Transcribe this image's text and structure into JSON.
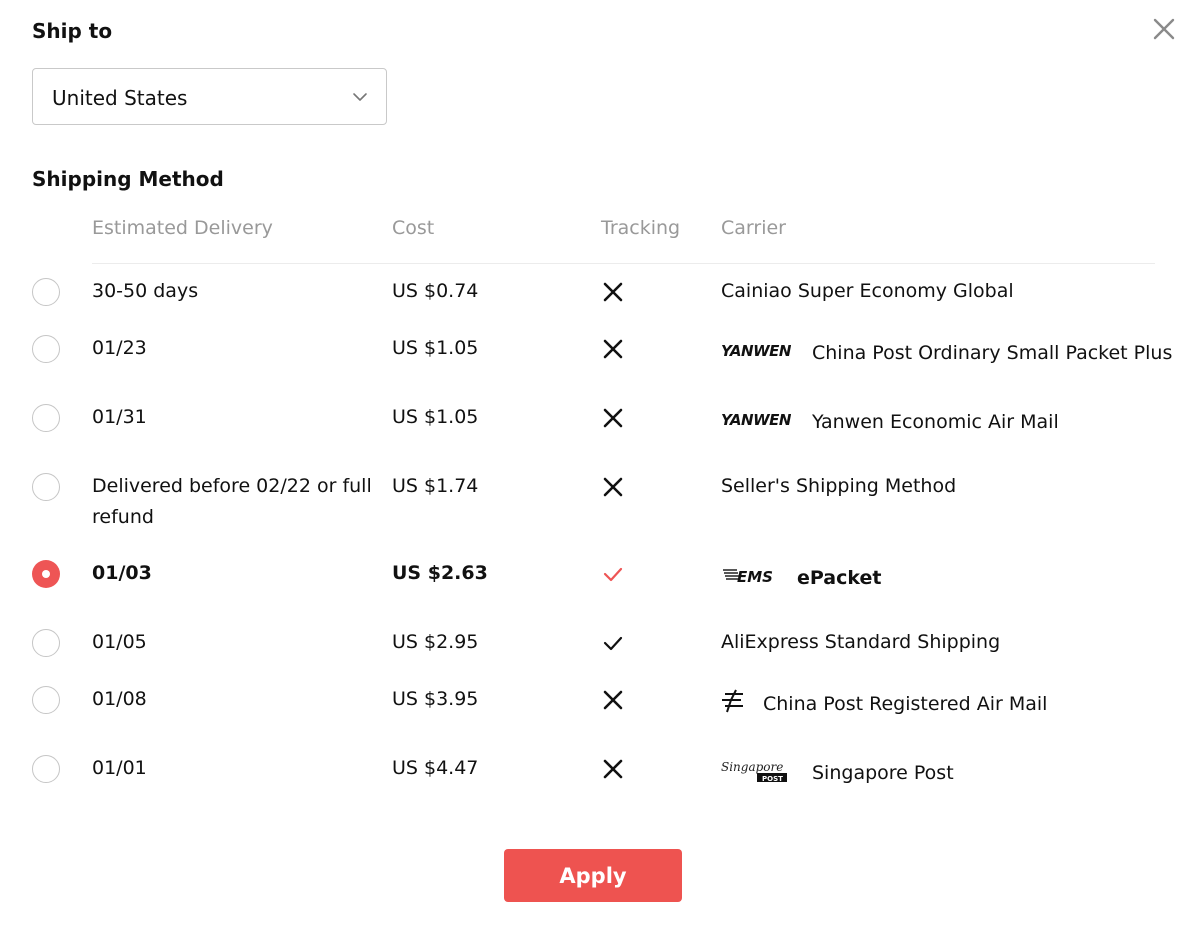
{
  "ship_to": {
    "title": "Ship to",
    "selected_country": "United States"
  },
  "shipping_method": {
    "title": "Shipping Method",
    "columns": [
      "Estimated Delivery",
      "Cost",
      "Tracking",
      "Carrier"
    ],
    "rows": [
      {
        "delivery": "30-50 days",
        "cost": "US $0.74",
        "tracking": false,
        "carrier": "Cainiao Super Economy Global",
        "logo": null,
        "selected": false
      },
      {
        "delivery": "01/23",
        "cost": "US $1.05",
        "tracking": false,
        "carrier": "China Post Ordinary Small Packet Plus",
        "logo": "yanwen-logo",
        "logo_text": "YANWEN",
        "selected": false
      },
      {
        "delivery": "01/31",
        "cost": "US $1.05",
        "tracking": false,
        "carrier": "Yanwen Economic Air Mail",
        "logo": "yanwen-logo",
        "logo_text": "YANWEN",
        "selected": false
      },
      {
        "delivery": "Delivered before 02/22 or full refund",
        "cost": "US $1.74",
        "tracking": false,
        "carrier": "Seller's Shipping Method",
        "logo": null,
        "selected": false
      },
      {
        "delivery": "01/03",
        "cost": "US $2.63",
        "tracking": true,
        "carrier": "ePacket",
        "logo": "ems-logo",
        "logo_text": "EMS",
        "selected": true
      },
      {
        "delivery": "01/05",
        "cost": "US $2.95",
        "tracking": true,
        "carrier": "AliExpress Standard Shipping",
        "logo": null,
        "selected": false
      },
      {
        "delivery": "01/08",
        "cost": "US $3.95",
        "tracking": false,
        "carrier": "China Post Registered Air Mail",
        "logo": "china-post-logo",
        "selected": false
      },
      {
        "delivery": "01/01",
        "cost": "US $4.47",
        "tracking": false,
        "carrier": "Singapore Post",
        "logo": "singapore-post-logo",
        "logo_text": "Singapore",
        "logo_subtext": "POST",
        "selected": false
      }
    ]
  },
  "apply_label": "Apply",
  "colors": {
    "accent": "#ee5350",
    "muted_text": "#999999",
    "text": "#111111",
    "border": "#c9c9c9"
  },
  "icons": {
    "close": "close-icon",
    "dropdown": "chevron-down-icon",
    "tracking_yes": "check-icon",
    "tracking_no": "x-icon"
  }
}
